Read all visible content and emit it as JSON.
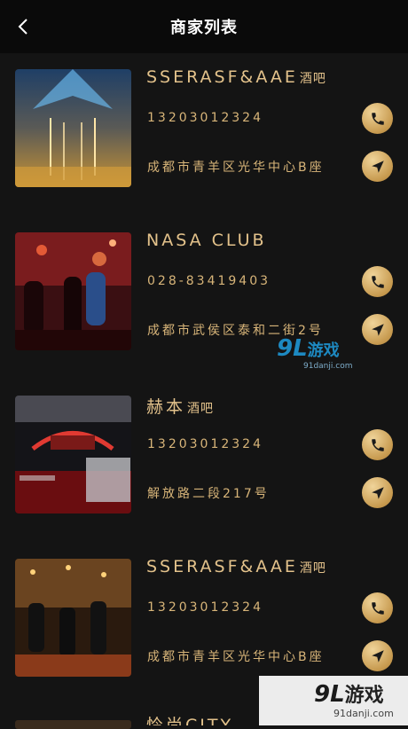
{
  "header": {
    "title": "商家列表"
  },
  "merchants": [
    {
      "name": "SSERASF&AAE",
      "suffix": "酒吧",
      "phone": "13203012324",
      "address": "成都市青羊区光华中心B座"
    },
    {
      "name": "NASA CLUB",
      "suffix": "",
      "phone": "028-83419403",
      "address": "成都市武侯区泰和二街2号"
    },
    {
      "name": "赫本",
      "suffix": "酒吧",
      "phone": "13203012324",
      "address": "解放路二段217号"
    },
    {
      "name": "SSERASF&AAE",
      "suffix": "酒吧",
      "phone": "13203012324",
      "address": "成都市青羊区光华中心B座"
    },
    {
      "name": "怜尚CITY",
      "suffix": ""
    }
  ],
  "watermark": {
    "logo": "9L",
    "name": "游戏",
    "url": "91danji.com"
  },
  "colors": {
    "gold": "#d9b77a",
    "background": "#141414",
    "header": "#0a0a0a"
  }
}
